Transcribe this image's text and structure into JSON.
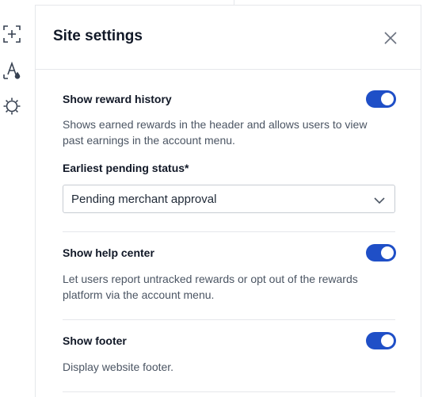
{
  "rail": {
    "icons": [
      "add-frame-icon",
      "text-color-icon",
      "brightness-icon"
    ]
  },
  "panel": {
    "title": "Site settings",
    "close_icon": "close-icon"
  },
  "settings": {
    "reward_history": {
      "title": "Show reward history",
      "description": "Shows earned rewards in the header and allows users to view past earnings in the account menu.",
      "enabled": true
    },
    "pending_status": {
      "label": "Earliest pending status*",
      "selected": "Pending merchant approval"
    },
    "help_center": {
      "title": "Show help center",
      "description": "Let users report untracked rewards or opt out of the rewards platform via the account menu.",
      "enabled": true
    },
    "footer": {
      "title": "Show footer",
      "description": "Display website footer.",
      "enabled": true
    }
  },
  "colors": {
    "toggle_on": "#1f4fc7",
    "text_primary": "#111827",
    "text_secondary": "#4b5563",
    "border": "#e5e7eb"
  }
}
